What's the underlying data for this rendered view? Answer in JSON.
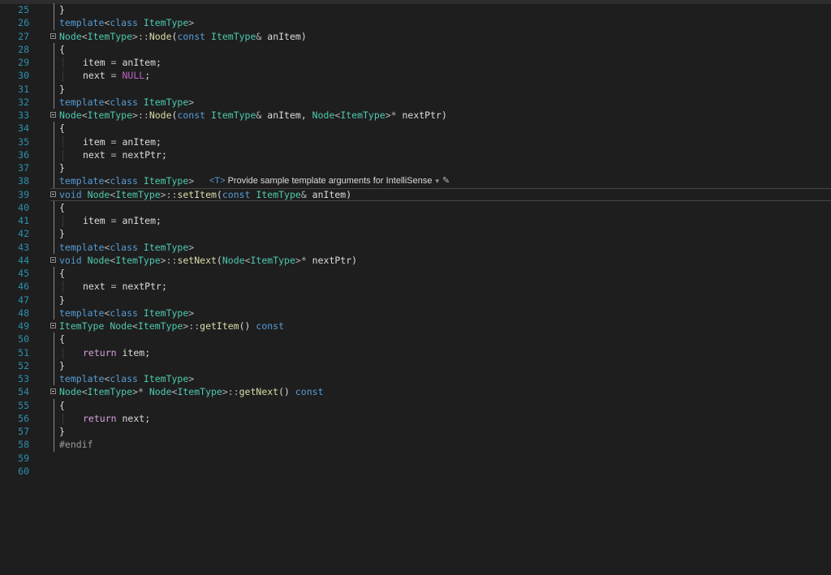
{
  "editor": {
    "lines": [
      {
        "num": "25",
        "fold": false,
        "tokens": [
          {
            "t": "}",
            "c": "t-id"
          }
        ]
      },
      {
        "num": "26",
        "fold": false,
        "tokens": [
          {
            "t": "template",
            "c": "t-kw"
          },
          {
            "t": "<",
            "c": "t-op"
          },
          {
            "t": "class",
            "c": "t-kw"
          },
          {
            "t": " ",
            "c": "t-id"
          },
          {
            "t": "ItemType",
            "c": "t-ty"
          },
          {
            "t": ">",
            "c": "t-op"
          }
        ]
      },
      {
        "num": "27",
        "fold": true,
        "tokens": [
          {
            "t": "Node",
            "c": "t-ty"
          },
          {
            "t": "<",
            "c": "t-op"
          },
          {
            "t": "ItemType",
            "c": "t-ty"
          },
          {
            "t": ">::",
            "c": "t-op"
          },
          {
            "t": "Node",
            "c": "t-fn"
          },
          {
            "t": "(",
            "c": "t-id"
          },
          {
            "t": "const",
            "c": "t-kw"
          },
          {
            "t": " ",
            "c": "t-id"
          },
          {
            "t": "ItemType",
            "c": "t-ty"
          },
          {
            "t": "& ",
            "c": "t-op"
          },
          {
            "t": "anItem",
            "c": "t-id"
          },
          {
            "t": ")",
            "c": "t-id"
          }
        ]
      },
      {
        "num": "28",
        "fold": false,
        "tokens": [
          {
            "t": "{",
            "c": "t-id"
          }
        ]
      },
      {
        "num": "29",
        "fold": false,
        "indent": true,
        "tokens": [
          {
            "t": "item",
            "c": "t-id"
          },
          {
            "t": " = ",
            "c": "t-op"
          },
          {
            "t": "anItem",
            "c": "t-id"
          },
          {
            "t": ";",
            "c": "t-id"
          }
        ]
      },
      {
        "num": "30",
        "fold": false,
        "indent": true,
        "tokens": [
          {
            "t": "next",
            "c": "t-id"
          },
          {
            "t": " = ",
            "c": "t-op"
          },
          {
            "t": "NULL",
            "c": "t-mc"
          },
          {
            "t": ";",
            "c": "t-id"
          }
        ]
      },
      {
        "num": "31",
        "fold": false,
        "tokens": [
          {
            "t": "}",
            "c": "t-id"
          }
        ]
      },
      {
        "num": "32",
        "fold": false,
        "tokens": [
          {
            "t": "template",
            "c": "t-kw"
          },
          {
            "t": "<",
            "c": "t-op"
          },
          {
            "t": "class",
            "c": "t-kw"
          },
          {
            "t": " ",
            "c": "t-id"
          },
          {
            "t": "ItemType",
            "c": "t-ty"
          },
          {
            "t": ">",
            "c": "t-op"
          }
        ]
      },
      {
        "num": "33",
        "fold": true,
        "tokens": [
          {
            "t": "Node",
            "c": "t-ty"
          },
          {
            "t": "<",
            "c": "t-op"
          },
          {
            "t": "ItemType",
            "c": "t-ty"
          },
          {
            "t": ">::",
            "c": "t-op"
          },
          {
            "t": "Node",
            "c": "t-fn"
          },
          {
            "t": "(",
            "c": "t-id"
          },
          {
            "t": "const",
            "c": "t-kw"
          },
          {
            "t": " ",
            "c": "t-id"
          },
          {
            "t": "ItemType",
            "c": "t-ty"
          },
          {
            "t": "& ",
            "c": "t-op"
          },
          {
            "t": "anItem",
            "c": "t-id"
          },
          {
            "t": ", ",
            "c": "t-id"
          },
          {
            "t": "Node",
            "c": "t-ty"
          },
          {
            "t": "<",
            "c": "t-op"
          },
          {
            "t": "ItemType",
            "c": "t-ty"
          },
          {
            "t": ">* ",
            "c": "t-op"
          },
          {
            "t": "nextPtr",
            "c": "t-id"
          },
          {
            "t": ")",
            "c": "t-id"
          }
        ]
      },
      {
        "num": "34",
        "fold": false,
        "tokens": [
          {
            "t": "{",
            "c": "t-id"
          }
        ]
      },
      {
        "num": "35",
        "fold": false,
        "indent": true,
        "tokens": [
          {
            "t": "item",
            "c": "t-id"
          },
          {
            "t": " = ",
            "c": "t-op"
          },
          {
            "t": "anItem",
            "c": "t-id"
          },
          {
            "t": ";",
            "c": "t-id"
          }
        ]
      },
      {
        "num": "36",
        "fold": false,
        "indent": true,
        "tokens": [
          {
            "t": "next",
            "c": "t-id"
          },
          {
            "t": " = ",
            "c": "t-op"
          },
          {
            "t": "nextPtr",
            "c": "t-id"
          },
          {
            "t": ";",
            "c": "t-id"
          }
        ]
      },
      {
        "num": "37",
        "fold": false,
        "tokens": [
          {
            "t": "}",
            "c": "t-id"
          }
        ]
      },
      {
        "num": "38",
        "fold": false,
        "intelli": true,
        "tokens": [
          {
            "t": "template",
            "c": "t-kw"
          },
          {
            "t": "<",
            "c": "t-op"
          },
          {
            "t": "class",
            "c": "t-kw"
          },
          {
            "t": " ",
            "c": "t-id"
          },
          {
            "t": "ItemType",
            "c": "t-ty"
          },
          {
            "t": ">",
            "c": "t-op"
          }
        ]
      },
      {
        "num": "39",
        "fold": true,
        "current": true,
        "tokens": [
          {
            "t": "void",
            "c": "t-kw"
          },
          {
            "t": " ",
            "c": "t-id"
          },
          {
            "t": "Node",
            "c": "t-ty"
          },
          {
            "t": "<",
            "c": "t-op"
          },
          {
            "t": "ItemType",
            "c": "t-ty"
          },
          {
            "t": ">::",
            "c": "t-op"
          },
          {
            "t": "setItem",
            "c": "t-fn"
          },
          {
            "t": "(",
            "c": "t-id"
          },
          {
            "t": "const",
            "c": "t-kw"
          },
          {
            "t": " ",
            "c": "t-id"
          },
          {
            "t": "ItemType",
            "c": "t-ty"
          },
          {
            "t": "& ",
            "c": "t-op"
          },
          {
            "t": "anItem",
            "c": "t-id"
          },
          {
            "t": ")",
            "c": "t-id"
          }
        ]
      },
      {
        "num": "40",
        "fold": false,
        "tokens": [
          {
            "t": "{",
            "c": "t-id"
          }
        ]
      },
      {
        "num": "41",
        "fold": false,
        "indent": true,
        "tokens": [
          {
            "t": "item",
            "c": "t-id"
          },
          {
            "t": " = ",
            "c": "t-op"
          },
          {
            "t": "anItem",
            "c": "t-id"
          },
          {
            "t": ";",
            "c": "t-id"
          }
        ]
      },
      {
        "num": "42",
        "fold": false,
        "tokens": [
          {
            "t": "}",
            "c": "t-id"
          }
        ]
      },
      {
        "num": "43",
        "fold": false,
        "tokens": [
          {
            "t": "template",
            "c": "t-kw"
          },
          {
            "t": "<",
            "c": "t-op"
          },
          {
            "t": "class",
            "c": "t-kw"
          },
          {
            "t": " ",
            "c": "t-id"
          },
          {
            "t": "ItemType",
            "c": "t-ty"
          },
          {
            "t": ">",
            "c": "t-op"
          }
        ]
      },
      {
        "num": "44",
        "fold": true,
        "tokens": [
          {
            "t": "void",
            "c": "t-kw"
          },
          {
            "t": " ",
            "c": "t-id"
          },
          {
            "t": "Node",
            "c": "t-ty"
          },
          {
            "t": "<",
            "c": "t-op"
          },
          {
            "t": "ItemType",
            "c": "t-ty"
          },
          {
            "t": ">::",
            "c": "t-op"
          },
          {
            "t": "setNext",
            "c": "t-fn"
          },
          {
            "t": "(",
            "c": "t-id"
          },
          {
            "t": "Node",
            "c": "t-ty"
          },
          {
            "t": "<",
            "c": "t-op"
          },
          {
            "t": "ItemType",
            "c": "t-ty"
          },
          {
            "t": ">* ",
            "c": "t-op"
          },
          {
            "t": "nextPtr",
            "c": "t-id"
          },
          {
            "t": ")",
            "c": "t-id"
          }
        ]
      },
      {
        "num": "45",
        "fold": false,
        "tokens": [
          {
            "t": "{",
            "c": "t-id"
          }
        ]
      },
      {
        "num": "46",
        "fold": false,
        "indent": true,
        "tokens": [
          {
            "t": "next",
            "c": "t-id"
          },
          {
            "t": " = ",
            "c": "t-op"
          },
          {
            "t": "nextPtr",
            "c": "t-id"
          },
          {
            "t": ";",
            "c": "t-id"
          }
        ]
      },
      {
        "num": "47",
        "fold": false,
        "tokens": [
          {
            "t": "}",
            "c": "t-id"
          }
        ]
      },
      {
        "num": "48",
        "fold": false,
        "tokens": [
          {
            "t": "template",
            "c": "t-kw"
          },
          {
            "t": "<",
            "c": "t-op"
          },
          {
            "t": "class",
            "c": "t-kw"
          },
          {
            "t": " ",
            "c": "t-id"
          },
          {
            "t": "ItemType",
            "c": "t-ty"
          },
          {
            "t": ">",
            "c": "t-op"
          }
        ]
      },
      {
        "num": "49",
        "fold": true,
        "tokens": [
          {
            "t": "ItemType",
            "c": "t-ty"
          },
          {
            "t": " ",
            "c": "t-id"
          },
          {
            "t": "Node",
            "c": "t-ty"
          },
          {
            "t": "<",
            "c": "t-op"
          },
          {
            "t": "ItemType",
            "c": "t-ty"
          },
          {
            "t": ">::",
            "c": "t-op"
          },
          {
            "t": "getItem",
            "c": "t-fn"
          },
          {
            "t": "() ",
            "c": "t-id"
          },
          {
            "t": "const",
            "c": "t-kw"
          }
        ]
      },
      {
        "num": "50",
        "fold": false,
        "tokens": [
          {
            "t": "{",
            "c": "t-id"
          }
        ]
      },
      {
        "num": "51",
        "fold": false,
        "indent": true,
        "tokens": [
          {
            "t": "return",
            "c": "t-kf"
          },
          {
            "t": " ",
            "c": "t-id"
          },
          {
            "t": "item",
            "c": "t-id"
          },
          {
            "t": ";",
            "c": "t-id"
          }
        ]
      },
      {
        "num": "52",
        "fold": false,
        "tokens": [
          {
            "t": "}",
            "c": "t-id"
          }
        ]
      },
      {
        "num": "53",
        "fold": false,
        "tokens": [
          {
            "t": "template",
            "c": "t-kw"
          },
          {
            "t": "<",
            "c": "t-op"
          },
          {
            "t": "class",
            "c": "t-kw"
          },
          {
            "t": " ",
            "c": "t-id"
          },
          {
            "t": "ItemType",
            "c": "t-ty"
          },
          {
            "t": ">",
            "c": "t-op"
          }
        ]
      },
      {
        "num": "54",
        "fold": true,
        "tokens": [
          {
            "t": "Node",
            "c": "t-ty"
          },
          {
            "t": "<",
            "c": "t-op"
          },
          {
            "t": "ItemType",
            "c": "t-ty"
          },
          {
            "t": ">* ",
            "c": "t-op"
          },
          {
            "t": "Node",
            "c": "t-ty"
          },
          {
            "t": "<",
            "c": "t-op"
          },
          {
            "t": "ItemType",
            "c": "t-ty"
          },
          {
            "t": ">::",
            "c": "t-op"
          },
          {
            "t": "getNext",
            "c": "t-fn"
          },
          {
            "t": "() ",
            "c": "t-id"
          },
          {
            "t": "const",
            "c": "t-kw"
          }
        ]
      },
      {
        "num": "55",
        "fold": false,
        "tokens": [
          {
            "t": "{",
            "c": "t-id"
          }
        ]
      },
      {
        "num": "56",
        "fold": false,
        "indent": true,
        "tokens": [
          {
            "t": "return",
            "c": "t-kf"
          },
          {
            "t": " ",
            "c": "t-id"
          },
          {
            "t": "next",
            "c": "t-id"
          },
          {
            "t": ";",
            "c": "t-id"
          }
        ]
      },
      {
        "num": "57",
        "fold": false,
        "tokens": [
          {
            "t": "}",
            "c": "t-id"
          }
        ]
      },
      {
        "num": "58",
        "fold": false,
        "tokens": [
          {
            "t": "#endif",
            "c": "t-pp"
          }
        ]
      },
      {
        "num": "59",
        "fold": false,
        "tokens": []
      },
      {
        "num": "60",
        "fold": false,
        "tokens": []
      }
    ],
    "intellisense": {
      "tag": "<T>",
      "message": "Provide sample template arguments for IntelliSense",
      "dropdown_icon": "chevron-down-icon",
      "edit_icon": "pencil-icon"
    }
  }
}
